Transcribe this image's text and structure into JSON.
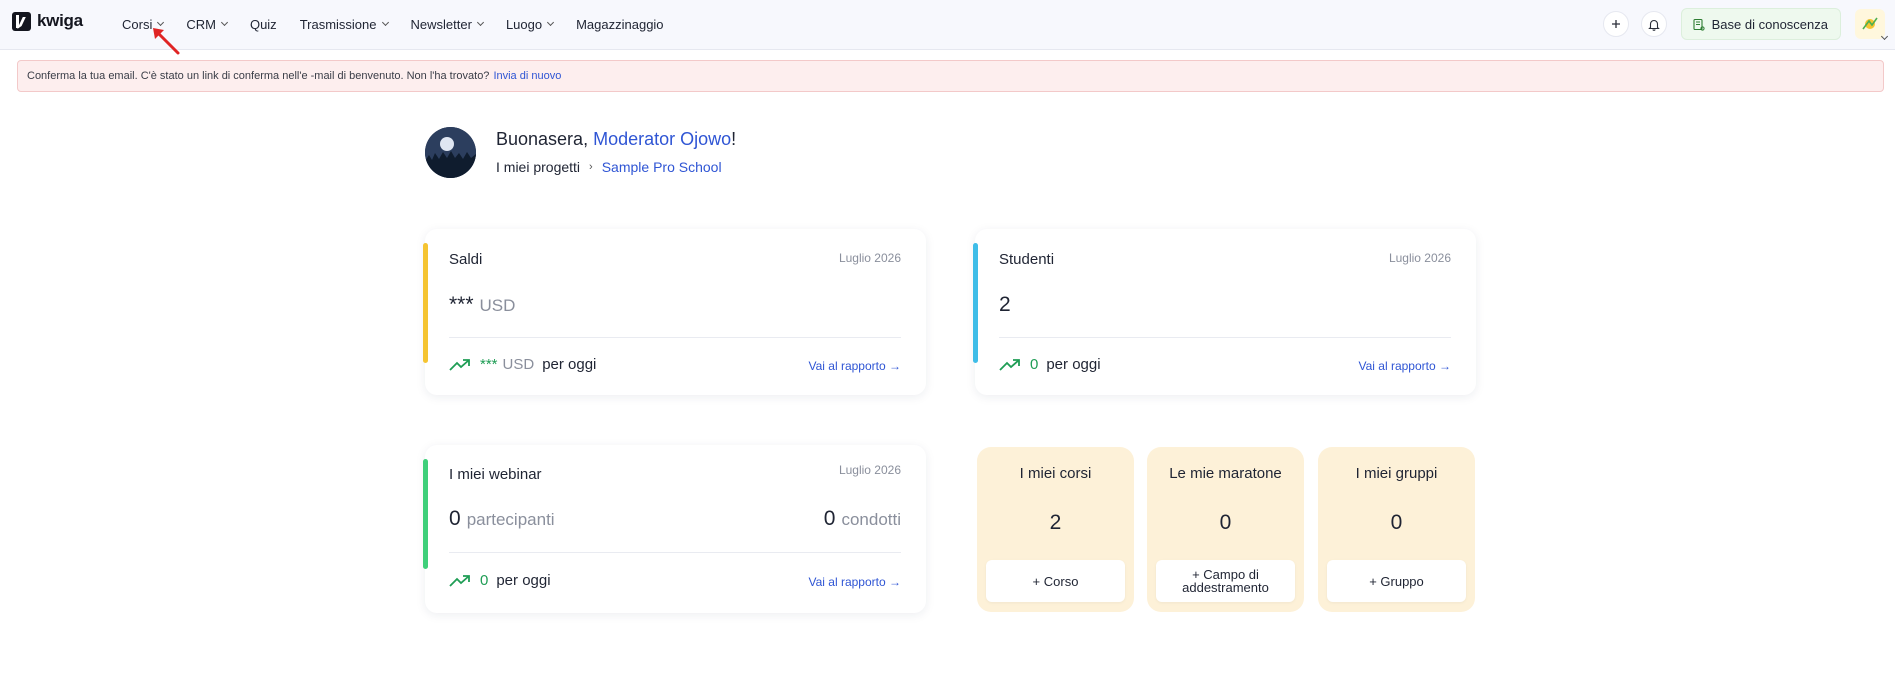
{
  "app": {
    "name": "kwiga"
  },
  "nav": {
    "items": [
      {
        "label": "Corsi",
        "dropdown": true
      },
      {
        "label": "CRM",
        "dropdown": true
      },
      {
        "label": "Quiz",
        "dropdown": false
      },
      {
        "label": "Trasmissione",
        "dropdown": true
      },
      {
        "label": "Newsletter",
        "dropdown": true
      },
      {
        "label": "Luogo",
        "dropdown": true
      },
      {
        "label": "Magazzinaggio",
        "dropdown": false
      }
    ]
  },
  "toolbar": {
    "add_icon": "plus-icon",
    "notifications_icon": "bell-icon",
    "knowledge_base_label": "Base di conoscenza"
  },
  "banner": {
    "text": "Conferma la tua email. C'è stato un link di conferma nell'e -mail di benvenuto. Non l'ha trovato?",
    "link": "Invia di nuovo"
  },
  "greeting": {
    "prefix": "Buonasera,",
    "user_name": "Moderator Ojowo",
    "suffix": "!",
    "breadcrumb_root": "I miei progetti",
    "breadcrumb_project": "Sample Pro School"
  },
  "cards": {
    "sales": {
      "title": "Saldi",
      "date": "Luglio 2026",
      "value": "***",
      "unit": "USD",
      "today_value": "***",
      "today_unit": "USD",
      "today_label": "per oggi",
      "report_link": "Vai al rapporto →",
      "accent": "#f5c431"
    },
    "students": {
      "title": "Studenti",
      "date": "Luglio 2026",
      "value": "2",
      "today_value": "0",
      "today_label": "per oggi",
      "report_link": "Vai al rapporto →",
      "accent": "#3fbde8"
    },
    "webinars": {
      "title": "I miei webinar",
      "date": "Luglio 2026",
      "participants_value": "0",
      "participants_label": "partecipanti",
      "held_value": "0",
      "held_label": "condotti",
      "today_value": "0",
      "today_label": "per oggi",
      "report_link": "Vai al rapporto →",
      "accent": "#3fcf7a"
    }
  },
  "tiles": [
    {
      "title": "I miei corsi",
      "count": "2",
      "button": "+ Corso"
    },
    {
      "title": "Le mie maratone",
      "count": "0",
      "button": "+ Campo di addestramento"
    },
    {
      "title": "I miei gruppi",
      "count": "0",
      "button": "+ Gruppo"
    }
  ],
  "colors": {
    "link": "#2f55d4",
    "positive": "#1f9d55",
    "tile_bg": "#fdf1d8",
    "banner_bg": "#fdeeee"
  }
}
